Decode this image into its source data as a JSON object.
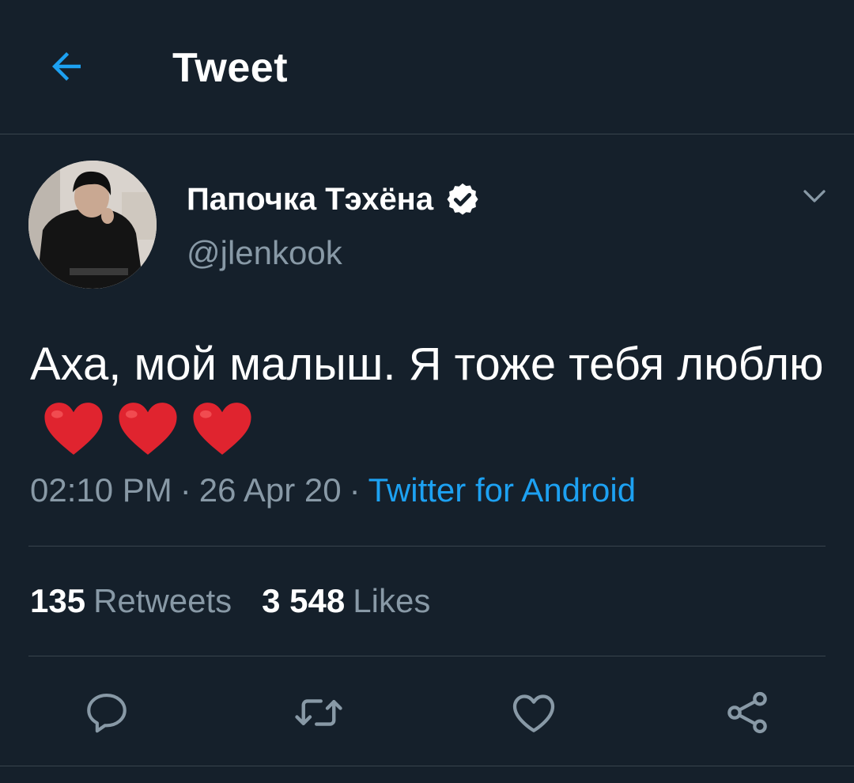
{
  "header": {
    "title": "Tweet",
    "back_icon": "arrow-left-icon",
    "accent_color": "#1da1f2"
  },
  "tweet": {
    "author": {
      "display_name": "Папочка Тэхёна",
      "handle": "@jlenkook",
      "verified": true
    },
    "text": "Аха, мой малыш. Я тоже тебя люблю",
    "emoji": [
      "red-heart-emoji",
      "red-heart-emoji",
      "red-heart-emoji"
    ],
    "time": "02:10 PM",
    "date": "26 Apr 20",
    "separator": "·",
    "source": "Twitter for Android",
    "stats": {
      "retweets_count": "135",
      "retweets_label": "Retweets",
      "likes_count": "3 548",
      "likes_label": "Likes"
    },
    "actions": [
      "reply-icon",
      "retweet-icon",
      "like-icon",
      "share-icon"
    ]
  },
  "colors": {
    "background": "#15202b",
    "secondary_text": "#8899a6",
    "divider": "#38444d"
  }
}
